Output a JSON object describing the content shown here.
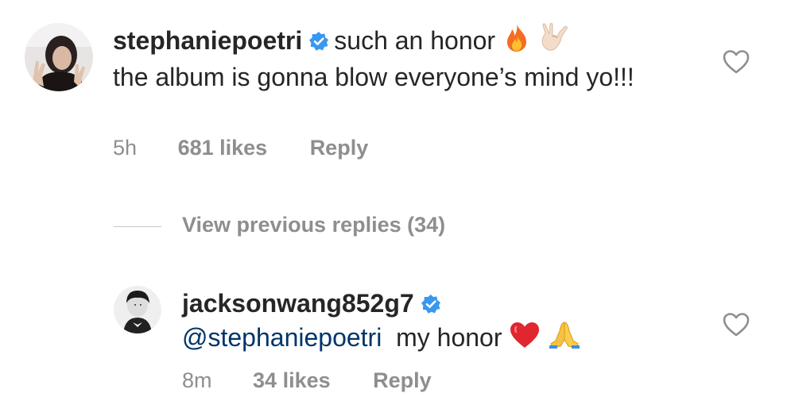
{
  "comment1": {
    "username": "stephaniepoetri",
    "text_first": "such an honor",
    "text_rest": "the album is gonna blow everyone’s mind yo!!!",
    "time": "5h",
    "likes": "681 likes",
    "reply": "Reply"
  },
  "view_previous": "View previous replies (34)",
  "comment2": {
    "username": "jacksonwang852g7",
    "mention": "@stephaniepoetri",
    "text": "my honor",
    "time": "8m",
    "likes": "34 likes",
    "reply": "Reply"
  },
  "colors": {
    "text": "#262626",
    "muted": "#8e8e8e",
    "verified": "#3897f0",
    "mention": "#003569"
  },
  "icons": [
    "verified-badge-icon",
    "fire-emoji-icon",
    "rock-on-hand-emoji-icon",
    "red-heart-emoji-icon",
    "folded-hands-emoji-icon",
    "heart-outline-icon"
  ]
}
